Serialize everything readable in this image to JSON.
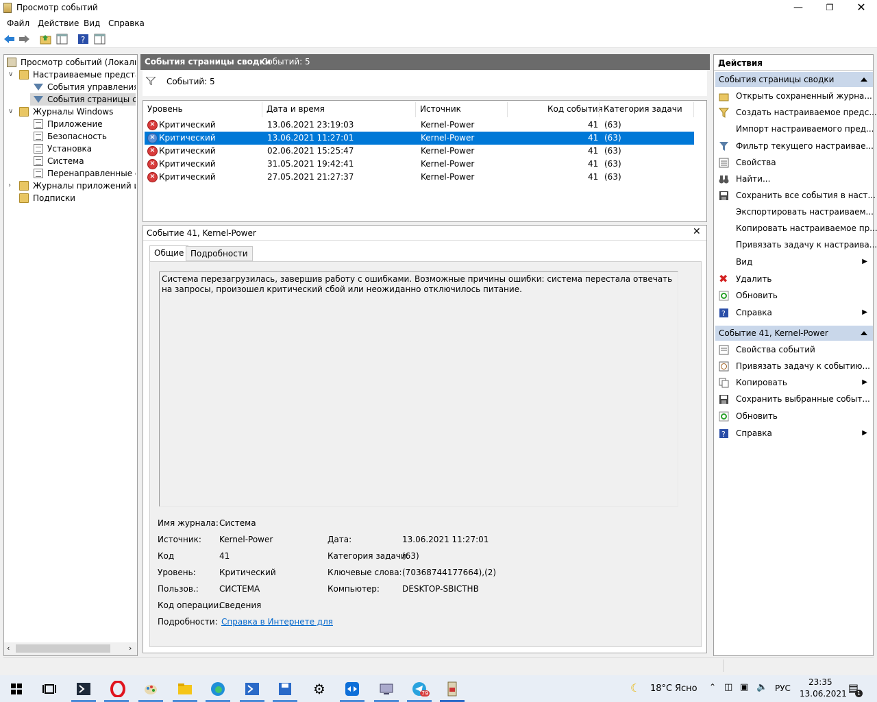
{
  "window": {
    "title": "Просмотр событий"
  },
  "menu": [
    "Файл",
    "Действие",
    "Вид",
    "Справка"
  ],
  "tree": {
    "items": [
      {
        "label": "Просмотр событий (Локальный)",
        "level": 0,
        "icon": "event-viewer-icon"
      },
      {
        "label": "Настраиваемые представления",
        "level": 1,
        "icon": "folder-icon"
      },
      {
        "label": "События управления",
        "level": 2,
        "icon": "filter-icon"
      },
      {
        "label": "События страницы сводки",
        "level": 2,
        "icon": "filter-icon"
      },
      {
        "label": "Журналы Windows",
        "level": 1,
        "icon": "folder-icon"
      },
      {
        "label": "Приложение",
        "level": 2,
        "icon": "log-icon"
      },
      {
        "label": "Безопасность",
        "level": 2,
        "icon": "log-icon"
      },
      {
        "label": "Установка",
        "level": 2,
        "icon": "log-icon"
      },
      {
        "label": "Система",
        "level": 2,
        "icon": "log-icon"
      },
      {
        "label": "Перенаправленные события",
        "level": 2,
        "icon": "log-icon"
      },
      {
        "label": "Журналы приложений и служб",
        "level": 1,
        "icon": "folder-icon"
      },
      {
        "label": "Подписки",
        "level": 1,
        "icon": "folder-icon"
      }
    ]
  },
  "center": {
    "header_title": "События страницы сводки",
    "header_count": "Событий: 5",
    "filter_count": "Событий: 5",
    "columns": [
      "Уровень",
      "Дата и время",
      "Источник",
      "Код события",
      "Категория задачи"
    ],
    "rows": [
      {
        "level": "Критический",
        "datetime": "13.06.2021 23:19:03",
        "source": "Kernel-Power",
        "id": "41",
        "category": "(63)"
      },
      {
        "level": "Критический",
        "datetime": "13.06.2021 11:27:01",
        "source": "Kernel-Power",
        "id": "41",
        "category": "(63)"
      },
      {
        "level": "Критический",
        "datetime": "02.06.2021 15:25:47",
        "source": "Kernel-Power",
        "id": "41",
        "category": "(63)"
      },
      {
        "level": "Критический",
        "datetime": "31.05.2021 19:42:41",
        "source": "Kernel-Power",
        "id": "41",
        "category": "(63)"
      },
      {
        "level": "Критический",
        "datetime": "27.05.2021 21:27:37",
        "source": "Kernel-Power",
        "id": "41",
        "category": "(63)"
      }
    ]
  },
  "detail": {
    "title": "Событие 41, Kernel-Power",
    "tabs": [
      "Общие",
      "Подробности"
    ],
    "description": "Система перезагрузилась, завершив работу с ошибками. Возможные причины ошибки: система перестала отвечать на запросы, произошел критический сбой или неожиданно отключилось питание.",
    "fields": {
      "log_name_label": "Имя журнала:",
      "log_name": "Система",
      "source_label": "Источник:",
      "source": "Kernel-Power",
      "date_label": "Дата:",
      "date": "13.06.2021 11:27:01",
      "code_label": "Код",
      "code": "41",
      "task_label": "Категория задачи:",
      "task": "(63)",
      "level_label": "Уровень:",
      "level": "Критический",
      "keywords_label": "Ключевые слова:",
      "keywords": "(70368744177664),(2)",
      "user_label": "Пользов.:",
      "user": "СИСТЕМА",
      "computer_label": "Компьютер:",
      "computer": "DESKTOP-SBICTHB",
      "opcode_label": "Код операции:",
      "opcode": "Сведения",
      "more_label": "Подробности:",
      "more_link": "Справка в Интернете для "
    }
  },
  "actions": {
    "title": "Действия",
    "section1": {
      "title": "События страницы сводки",
      "items": [
        {
          "label": "Открыть сохраненный журна...",
          "icon": "open-folder-icon"
        },
        {
          "label": "Создать настраиваемое предс...",
          "icon": "create-filter-icon"
        },
        {
          "label": "Импорт настраиваемого пред...",
          "icon": ""
        },
        {
          "label": "Фильтр текущего настраивае...",
          "icon": "filter-icon"
        },
        {
          "label": "Свойства",
          "icon": "properties-icon"
        },
        {
          "label": "Найти...",
          "icon": "binoculars-icon"
        },
        {
          "label": "Сохранить все события в наст...",
          "icon": "save-icon"
        },
        {
          "label": "Экспортировать настраиваем...",
          "icon": ""
        },
        {
          "label": "Копировать настраиваемое пр...",
          "icon": ""
        },
        {
          "label": "Привязать задачу к настраива...",
          "icon": ""
        },
        {
          "label": "Вид",
          "icon": "",
          "submenu": true
        },
        {
          "label": "Удалить",
          "icon": "delete-icon"
        },
        {
          "label": "Обновить",
          "icon": "refresh-icon"
        },
        {
          "label": "Справка",
          "icon": "help-icon",
          "submenu": true
        }
      ]
    },
    "section2": {
      "title": "Событие 41, Kernel-Power",
      "items": [
        {
          "label": "Свойства событий",
          "icon": "event-properties-icon"
        },
        {
          "label": "Привязать задачу к событию...",
          "icon": "attach-task-icon"
        },
        {
          "label": "Копировать",
          "icon": "copy-icon",
          "submenu": true
        },
        {
          "label": "Сохранить выбранные событ...",
          "icon": "save-icon"
        },
        {
          "label": "Обновить",
          "icon": "refresh-icon"
        },
        {
          "label": "Справка",
          "icon": "help-icon",
          "submenu": true
        }
      ]
    }
  },
  "taskbar": {
    "weather_temp": "18°C",
    "weather_text": "Ясно",
    "language": "РУС",
    "time": "23:35",
    "date": "13.06.2021",
    "telegram_badge": "79",
    "notification_count": "1"
  },
  "colors": {
    "selection": "#0078d7",
    "section_header": "#c9d7ea",
    "critical": "#d83b3b"
  }
}
